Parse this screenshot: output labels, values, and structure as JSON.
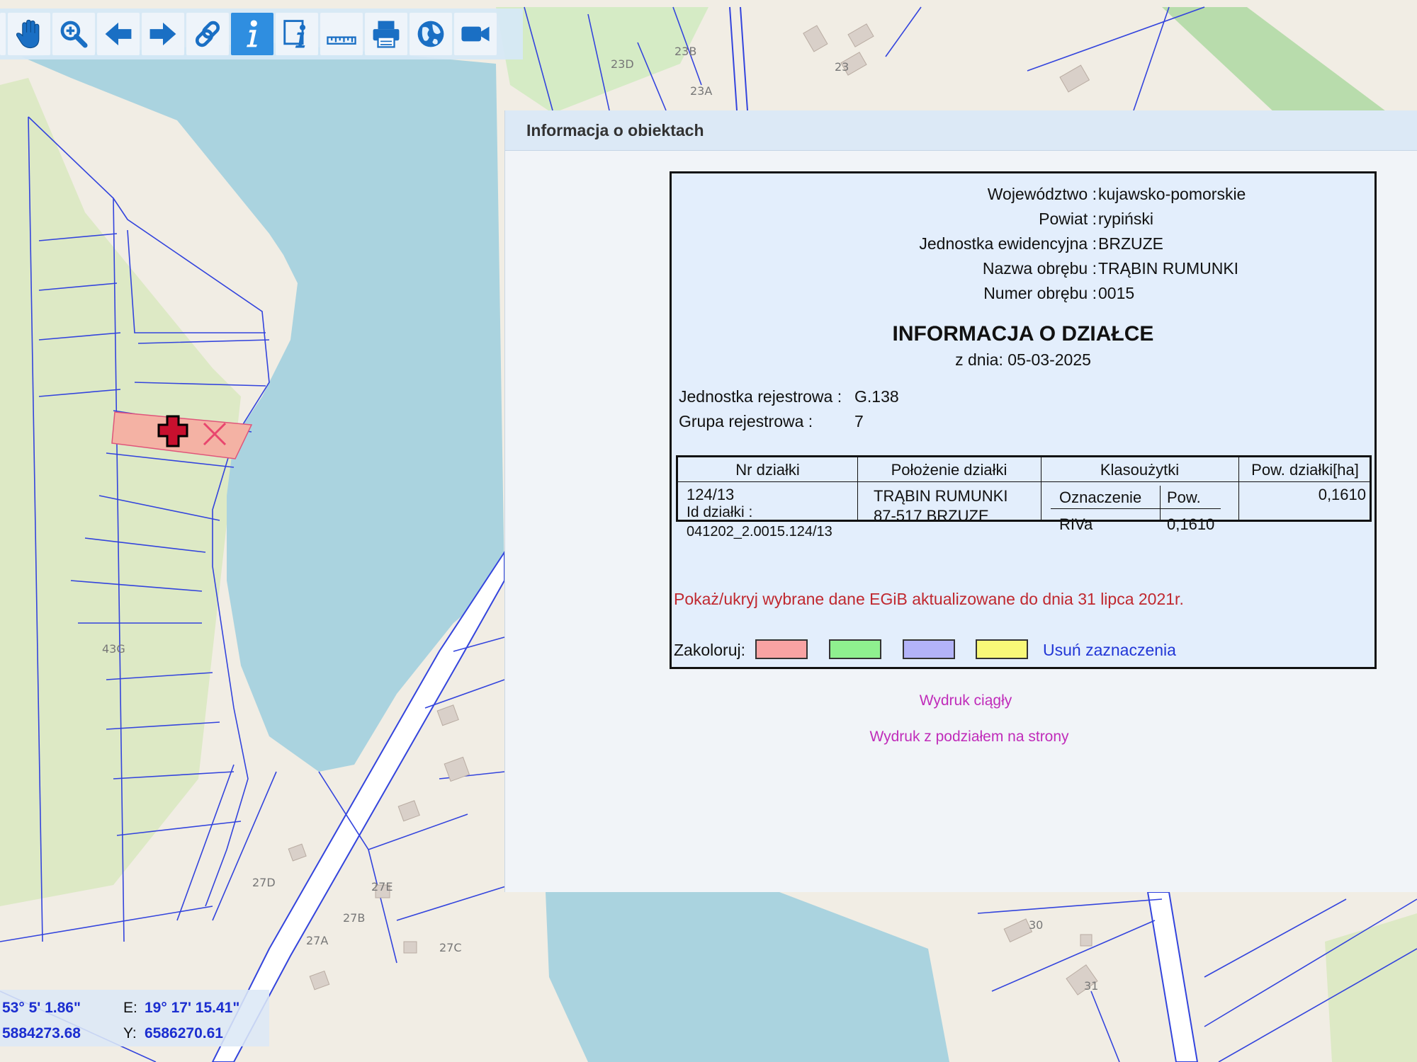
{
  "toolbar": {
    "buttons": [
      {
        "icon": "pan-hand-icon"
      },
      {
        "icon": "zoom-icon"
      },
      {
        "icon": "arrow-left-icon"
      },
      {
        "icon": "arrow-right-icon"
      },
      {
        "icon": "link-icon"
      },
      {
        "icon": "info-icon",
        "active": true
      },
      {
        "icon": "info-doc-icon"
      },
      {
        "icon": "ruler-icon"
      },
      {
        "icon": "printer-icon"
      },
      {
        "icon": "globe-icon"
      },
      {
        "icon": "video-camera-icon"
      }
    ]
  },
  "map": {
    "labels": {
      "l23d": "23D",
      "l23b": "23B",
      "l23a": "23A",
      "l23": "23",
      "l43g": "43G",
      "l27d": "27D",
      "l27e": "27E",
      "l27b": "27B",
      "l27a": "27A",
      "l27c": "27C",
      "l30": "30",
      "l31": "31"
    },
    "colors": {
      "water": "#aad3df",
      "land": "#f1ede4",
      "green": "#d2ebc5",
      "parcel_line": "#3344dd",
      "selection": "#f2a8a0"
    }
  },
  "panel": {
    "title": "Informacja o obiektach",
    "admin": [
      {
        "label": "Województwo :",
        "value": "kujawsko-pomorskie"
      },
      {
        "label": "Powiat :",
        "value": "rypiński"
      },
      {
        "label": "Jednostka ewidencyjna :",
        "value": "BRZUZE"
      },
      {
        "label": "Nazwa obrębu :",
        "value": "TRĄBIN RUMUNKI"
      },
      {
        "label": "Numer obrębu :",
        "value": "0015"
      }
    ],
    "heading": "INFORMACJA O DZIAŁCE",
    "date": "z dnia: 05-03-2025",
    "registry_unit_label": "Jednostka rejestrowa :",
    "registry_unit_value": "G.138",
    "registry_group_label": "Grupa rejestrowa :",
    "registry_group_value": "7",
    "table": {
      "headers": [
        "Nr działki",
        "Położenie działki",
        "Klasoużytki",
        "Pow. działki[ha]"
      ],
      "parcel_number": "124/13",
      "parcel_id_label": "Id działki :",
      "parcel_id": "041202_2.0015.124/13",
      "location_line1": "TRĄBIN RUMUNKI",
      "location_line2": "87-517 BRZUZE",
      "class_header_mark": "Oznaczenie",
      "class_header_area": "Pow.",
      "class_mark": "RIVa",
      "class_area": "0,1610",
      "area": "0,1610"
    },
    "egib_link": "Pokaż/ukryj wybrane dane EGiB aktualizowane do dnia 31 lipca 2021r.",
    "colorize_label": "Zakoloruj:",
    "swatch_colors": [
      "#f8a3a3",
      "#8ff08f",
      "#b3b3f8",
      "#f8f878"
    ],
    "clear_link": "Usuń zaznaczenia",
    "print_continuous": "Wydruk ciągły",
    "print_pages": "Wydruk z podziałem na strony"
  },
  "coords": {
    "lat_value": "53° 5' 1.86\"",
    "e_label": "E:",
    "lon_value": "19° 17' 15.41\"",
    "x_value": "5884273.68",
    "y_label": "Y:",
    "y_value": "6586270.61"
  }
}
